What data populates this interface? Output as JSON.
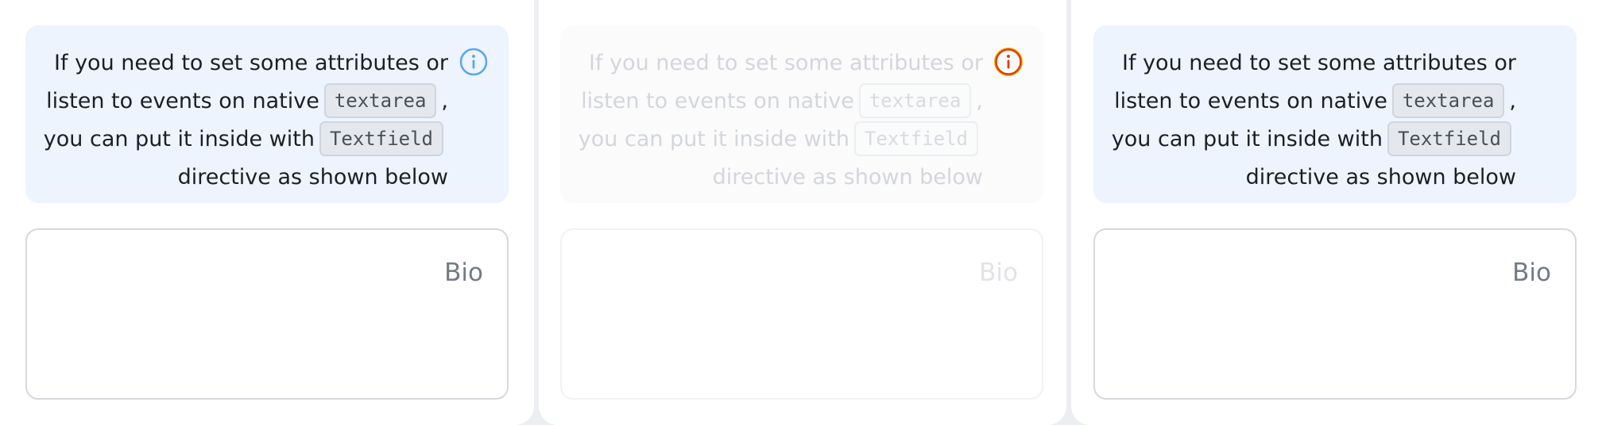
{
  "panels": [
    {
      "state": "default",
      "icon": "info-icon",
      "icon_color": "#5aa6e8",
      "message": {
        "line1": "If you need to set some attributes or",
        "line2_prefix": "listen to events on native",
        "code1": "textarea",
        "line2_suffix": ",",
        "line3_prefix": "you can put it inside with",
        "code2": "Textfield",
        "line4": "directive as shown below"
      },
      "textarea": {
        "label": "Bio",
        "value": ""
      }
    },
    {
      "state": "disabled",
      "icon": "info-icon",
      "icon_color": "#e33c00",
      "icon_ring_color": "#f2b400",
      "message": {
        "line1": "If you need to set some attributes or",
        "line2_prefix": "listen to events on native",
        "code1": "textarea",
        "line2_suffix": ",",
        "line3_prefix": "you can put it inside with",
        "code2": "Textfield",
        "line4": "directive as shown below"
      },
      "textarea": {
        "label": "Bio",
        "value": ""
      }
    },
    {
      "state": "default",
      "icon": null,
      "message": {
        "line1": "If you need to set some attributes or",
        "line2_prefix": "listen to events on native",
        "code1": "textarea",
        "line2_suffix": ",",
        "line3_prefix": "you can put it inside with",
        "code2": "Textfield",
        "line4": "directive as shown below"
      },
      "textarea": {
        "label": "Bio",
        "value": ""
      }
    }
  ],
  "colors": {
    "info_bg": "#edf4fd",
    "text": "#1c1f25",
    "label": "#737a86",
    "border": "#d6d9de"
  }
}
